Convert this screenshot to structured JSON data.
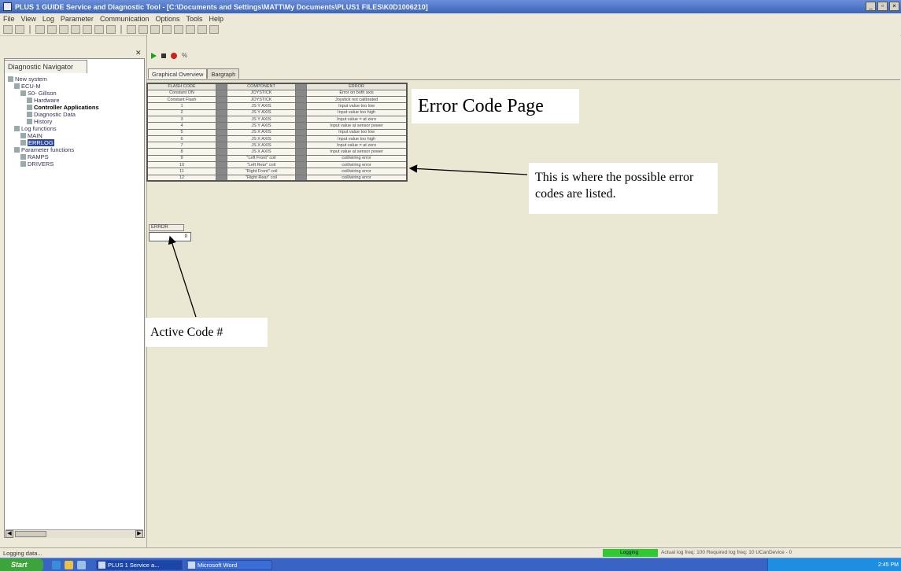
{
  "window": {
    "title": "PLUS 1 GUIDE Service and Diagnostic Tool - [C:\\Documents and Settings\\MATT\\My Documents\\PLUS1 FILES\\K0D1006210]",
    "min_label": "_",
    "max_label": "▫",
    "close_label": "×"
  },
  "menu": [
    "File",
    "View",
    "Log",
    "Parameter",
    "Communication",
    "Options",
    "Tools",
    "Help"
  ],
  "navigator": {
    "tab_label": "Diagnostic Navigator",
    "pin_label": "✕",
    "tree": [
      {
        "label": "New system"
      },
      {
        "label": "ECU-M"
      },
      {
        "label": "S0- Gillson"
      },
      {
        "label": "Hardware"
      },
      {
        "label": "Controller Applications"
      },
      {
        "label": "Diagnostic Data"
      },
      {
        "label": "History"
      },
      {
        "label": "Log functions"
      },
      {
        "label": "MAIN"
      },
      {
        "label": "ERRLOG"
      },
      {
        "label": "Parameter functions"
      },
      {
        "label": "RAMPS"
      },
      {
        "label": "DRIVERS"
      }
    ]
  },
  "tabs": [
    "Graphical Overview",
    "Bargraph"
  ],
  "error_table": {
    "headers": [
      "FLASH CODE",
      "COMPONENT",
      "ERROR"
    ],
    "rows": [
      [
        "Constant ON",
        "JOYSTICK",
        "Error on both axis"
      ],
      [
        "Constant Flash",
        "JOYSTICK",
        "Joystick not calibrated"
      ],
      [
        "1",
        "JS Y AXIS",
        "Input value too low"
      ],
      [
        "2",
        "JS Y AXIS",
        "Input value too high"
      ],
      [
        "3",
        "JS Y AXIS",
        "Input value = at zero"
      ],
      [
        "4",
        "JS Y AXIS",
        "Input value at sensor power"
      ],
      [
        "5",
        "JS X AXIS",
        "Input value too low"
      ],
      [
        "6",
        "JS X AXIS",
        "Input value too high"
      ],
      [
        "7",
        "JS X AXIS",
        "Input value = at zero"
      ],
      [
        "8",
        "JS X AXIS",
        "Input value at sensor power"
      ],
      [
        "9",
        "\"Left Front\" coil",
        "coil/wiring error"
      ],
      [
        "10",
        "\"Left Rear\" coil",
        "coil/wiring error"
      ],
      [
        "11",
        "\"Right Front\" coil",
        "coil/wiring error"
      ],
      [
        "12",
        "\"Right Rear\" coil",
        "coil/wiring error"
      ]
    ]
  },
  "error_field": {
    "label": "ERROR",
    "value": "0"
  },
  "annotations": {
    "title": "Error Code Page",
    "description": "This is where the possible error codes are listed.",
    "active_code": "Active Code #"
  },
  "status": {
    "text": "Logging data...",
    "logging_badge": "Logging",
    "freq_text": "Actual log freq: 100   Required log freq: 10 UCanDevice - 0"
  },
  "taskbar": {
    "start_label": "Start",
    "buttons": [
      "PLUS 1 Service a...",
      "Microsoft Word"
    ],
    "clock": "2:45 PM"
  },
  "colors": {
    "titlebar": "#3c64b8",
    "content_bg": "#eae7d2",
    "logging_green": "#32c832",
    "taskbar": "#3a64c4"
  }
}
